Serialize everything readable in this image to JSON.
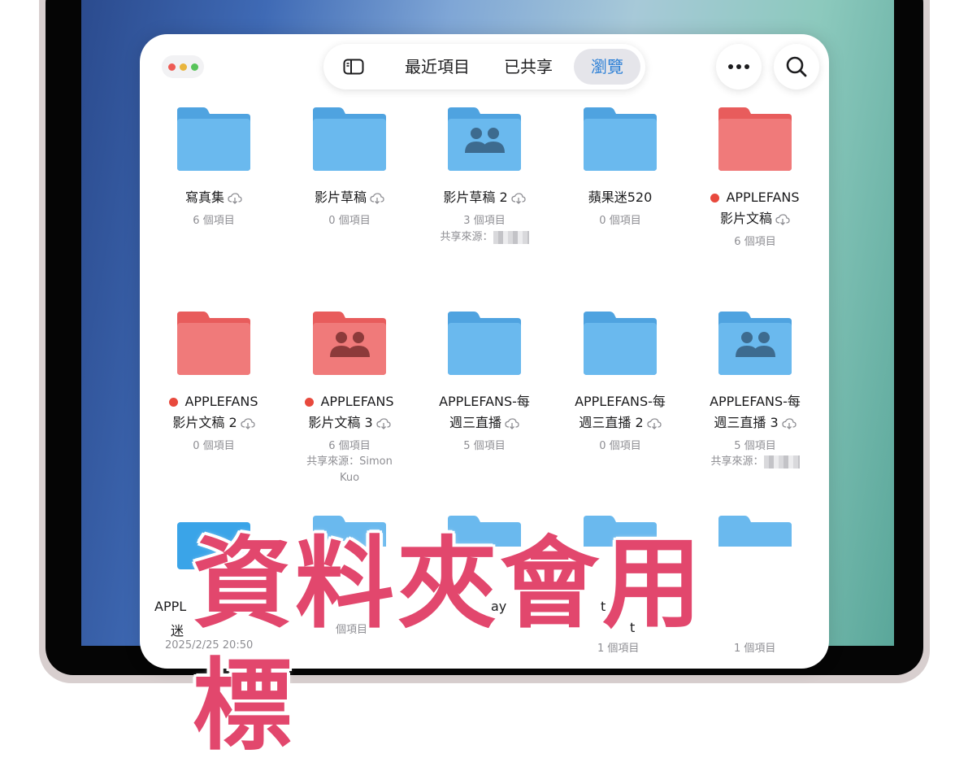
{
  "colors": {
    "folder_blue": "#5aaee6",
    "folder_red": "#ee6b6b",
    "tag_red": "#e8493d",
    "overlay_text": "#e2476d"
  },
  "window": {
    "controls": [
      "close",
      "minimize",
      "zoom"
    ]
  },
  "tabs": {
    "sidebar_icon": "sidebar-icon",
    "recent_label": "最近項目",
    "shared_label": "已共享",
    "browse_label": "瀏覽",
    "active": "瀏覽"
  },
  "toolbar": {
    "more_icon": "ellipsis-icon",
    "search_icon": "magnifier-icon"
  },
  "folders": [
    {
      "name": "寫真集",
      "count": "6 個項目",
      "cloud": true,
      "color": "blue",
      "shared_icon": false
    },
    {
      "name": "影片草稿",
      "count": "0 個項目",
      "cloud": true,
      "color": "blue",
      "shared_icon": false
    },
    {
      "name": "影片草稿 2",
      "count": "3 個項目",
      "cloud": true,
      "color": "blue",
      "shared_icon": true,
      "shared_from": "共享來源："
    },
    {
      "name": "蘋果迷520",
      "count": "0 個項目",
      "cloud": false,
      "color": "blue",
      "shared_icon": false
    },
    {
      "name_line1": "APPLEFANS",
      "name_line2": "影片文稿",
      "count": "6 個項目",
      "cloud": true,
      "color": "red",
      "tag": "red",
      "shared_icon": false
    },
    {
      "name_line1": "APPLEFANS",
      "name_line2": "影片文稿 2",
      "count": "0 個項目",
      "cloud": true,
      "color": "red",
      "tag": "red",
      "shared_icon": false
    },
    {
      "name_line1": "APPLEFANS",
      "name_line2": "影片文稿 3",
      "count": "6 個項目",
      "cloud": true,
      "color": "red",
      "tag": "red",
      "shared_icon": true,
      "shared_from_line1": "共享來源：Simon",
      "shared_from_line2": "Kuo"
    },
    {
      "name_line1": "APPLEFANS-每",
      "name_line2": "週三直播",
      "count": "5 個項目",
      "cloud": true,
      "color": "blue",
      "shared_icon": false
    },
    {
      "name_line1": "APPLEFANS-每",
      "name_line2": "週三直播 2",
      "count": "0 個項目",
      "cloud": true,
      "color": "blue",
      "shared_icon": false
    },
    {
      "name_line1": "APPLEFANS-每",
      "name_line2": "週三直播 3",
      "count": "5 個項目",
      "cloud": true,
      "color": "blue",
      "shared_icon": true,
      "shared_from": "共享來源："
    }
  ],
  "partial_row": {
    "text_a": "APPL",
    "text_b": "迷",
    "text_c": "2025/2/25 20:50",
    "text_d": "個項目",
    "text_e": "ay",
    "text_f": "t",
    "text_g": "t",
    "text_h": "1 個項目",
    "text_i": "1 個項目"
  },
  "overlay": {
    "text": "資料夾會用標"
  }
}
